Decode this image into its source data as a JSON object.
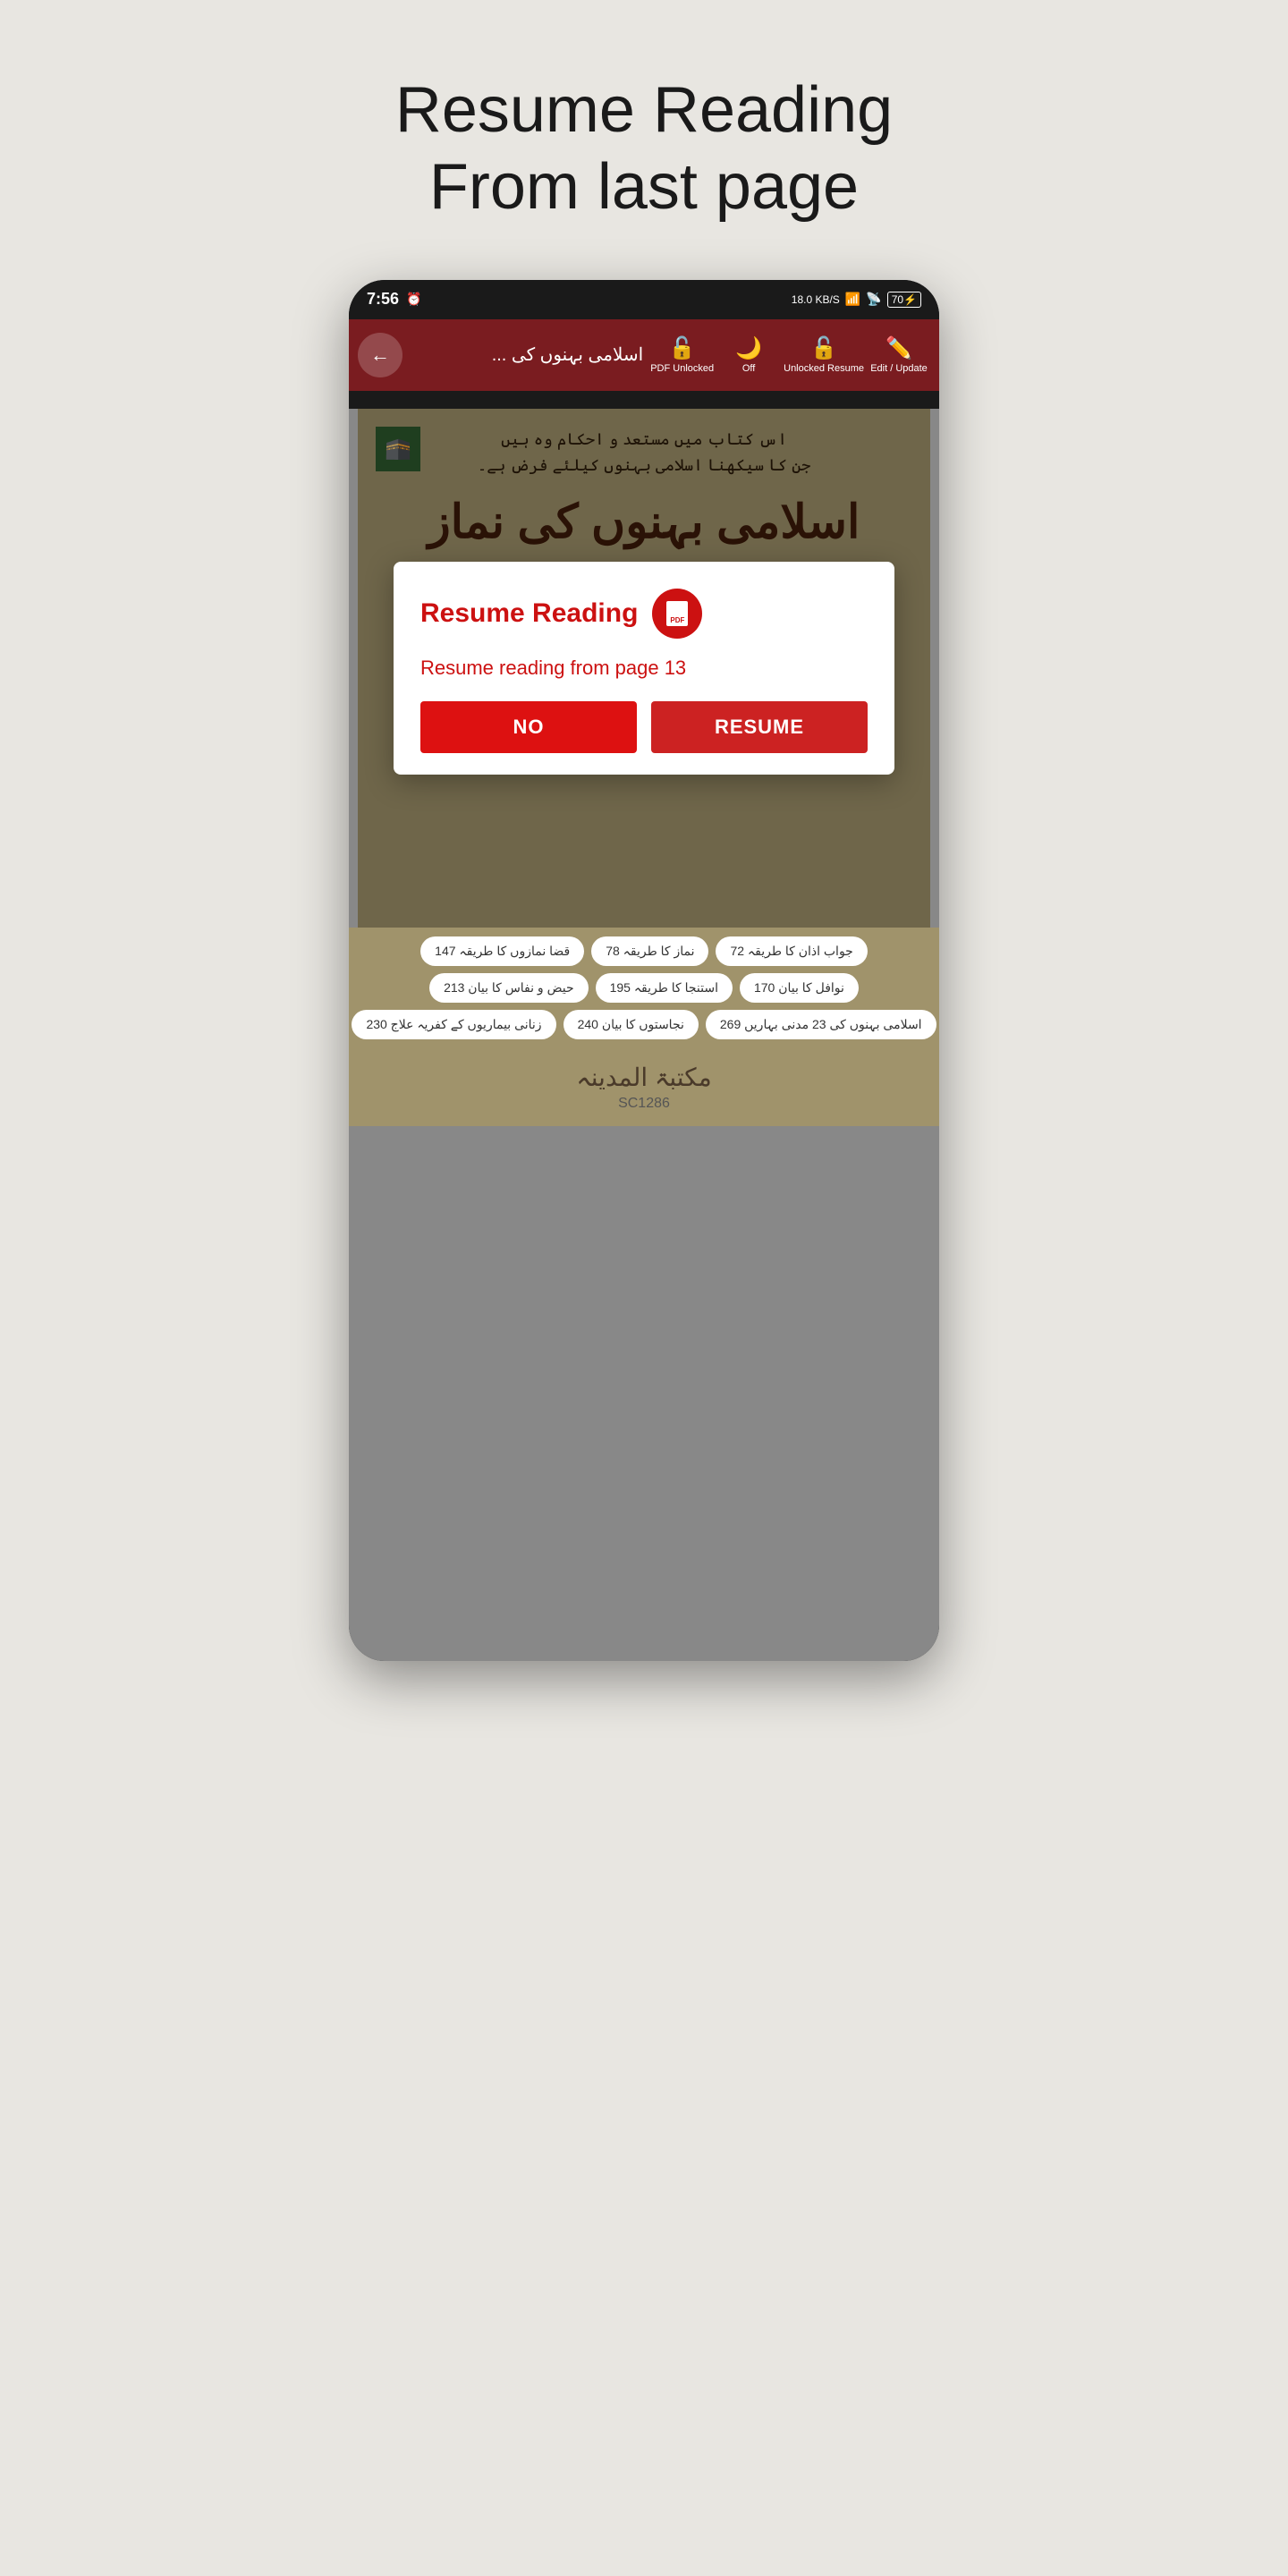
{
  "headline": {
    "line1": "Resume Reading",
    "line2": "From last page"
  },
  "statusBar": {
    "time": "7:56",
    "networkSpeed": "18.0 KB/S",
    "battery": "70"
  },
  "navBar": {
    "title": "اسلامی بہنوں کی ...",
    "backLabel": "←",
    "actions": [
      {
        "id": "pdf-unlocked",
        "icon": "🔓",
        "label": "PDF Unlocked"
      },
      {
        "id": "night-mode",
        "icon": "🌙",
        "label": "Off"
      },
      {
        "id": "unlocked-resume",
        "icon": "🔓",
        "label": "Unlocked Resume"
      },
      {
        "id": "edit-update",
        "icon": "✏️",
        "label": "Edit / Update"
      }
    ]
  },
  "bookContent": {
    "topText1": "اس کتاب میں مستعد و احکام وہ ہیں",
    "topText2": "جن کا سیکھنا اسلامی بہنوں کیلئے فرض ہے۔",
    "titleText": "اسلامی بہنوں کی نماز"
  },
  "dialog": {
    "title": "Resume Reading",
    "message": "Resume reading from page 13",
    "noLabel": "NO",
    "resumeLabel": "RESUME",
    "pdfIconText": "PDF"
  },
  "bookIndex": {
    "rows": [
      [
        "جواب اذان کا طریقہ 72",
        "نماز کا طریقہ 78",
        "قضا نمازوں کا طریقہ 147"
      ],
      [
        "نوافل کا بیان 170",
        "استنجا کا طریقہ 195",
        "حیض و نفاس کا بیان 213"
      ],
      [
        "زنانی بیماریوں کے کفریہ علاج 230",
        "نجاستوں کا بیان 240",
        "اسلامی بہنوں کی 23 مدنی بہاریں 269"
      ]
    ]
  },
  "publisher": {
    "logoText": "مکتبۃ المدینہ",
    "code": "SC1286"
  }
}
